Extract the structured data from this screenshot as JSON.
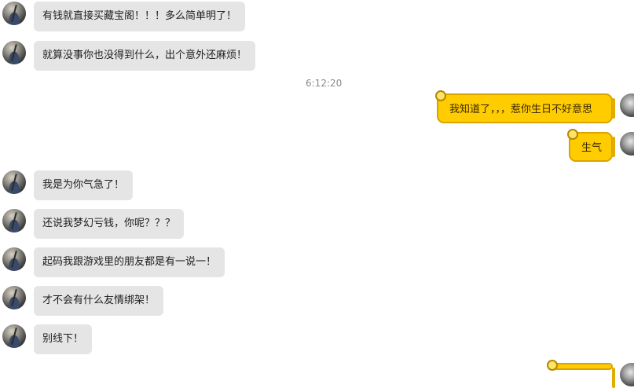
{
  "chat": {
    "timestamp": "6:12:20",
    "messages": [
      {
        "side": "left",
        "text": "有钱就直接买藏宝阁！！！多么简单明了！"
      },
      {
        "side": "left",
        "text": "就算没事你也没得到什么，出个意外还麻烦！"
      },
      {
        "side": "right",
        "text": "我知道了，，，惹你生日不好意思"
      },
      {
        "side": "right",
        "text": "生气"
      },
      {
        "side": "left",
        "text": "我是为你气急了！"
      },
      {
        "side": "left",
        "text": "还说我梦幻亏钱，你呢？？？"
      },
      {
        "side": "left",
        "text": "起码我跟游戏里的朋友都是有一说一！"
      },
      {
        "side": "left",
        "text": "才不会有什么友情绑架！"
      },
      {
        "side": "left",
        "text": "别线下！"
      }
    ]
  },
  "colors": {
    "incoming_bubble": "#e5e5e5",
    "outgoing_bubble": "#ffcc00",
    "outgoing_border": "#d9a300",
    "timestamp_text": "#8a8a8a"
  }
}
